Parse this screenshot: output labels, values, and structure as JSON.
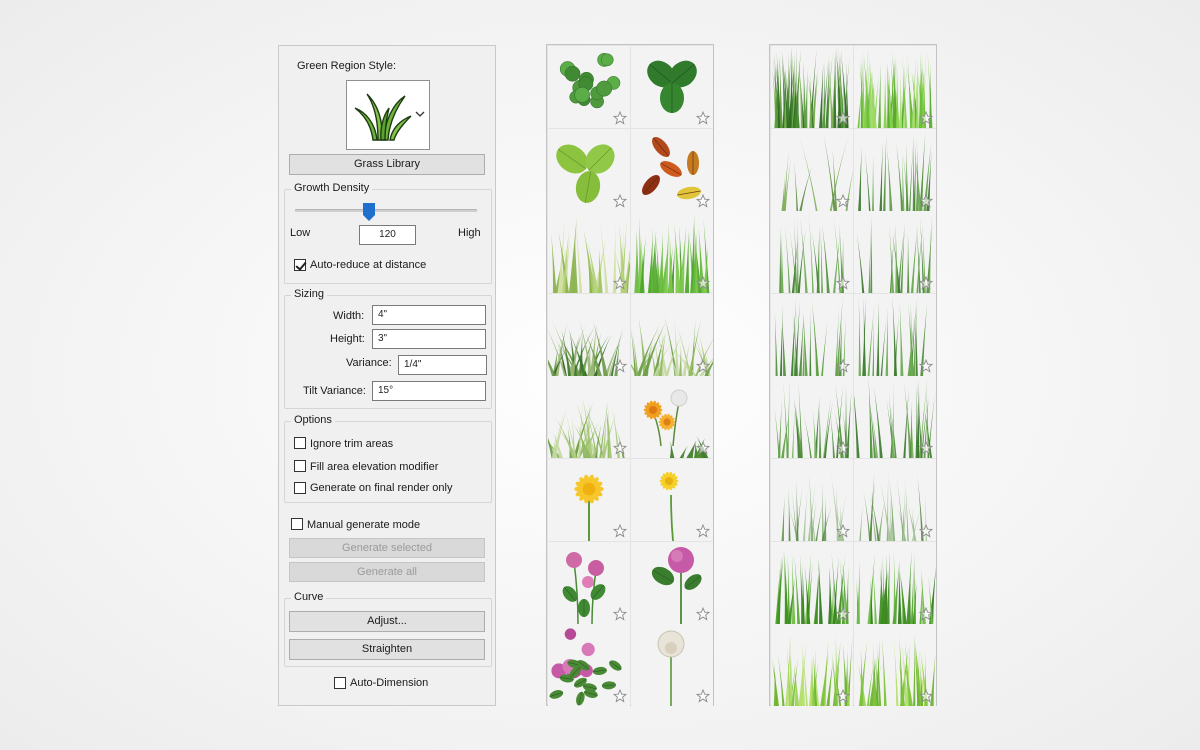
{
  "panel": {
    "green_region_style_label": "Green Region Style:",
    "library_button": "Grass Library",
    "growth": {
      "title": "Growth Density",
      "low": "Low",
      "high": "High",
      "value": "120",
      "auto_reduce": "Auto-reduce at distance",
      "auto_reduce_checked": true
    },
    "sizing": {
      "title": "Sizing",
      "width_label": "Width:",
      "width_value": "4\"",
      "height_label": "Height:",
      "height_value": "3\"",
      "variance_label": "Variance:",
      "variance_value": "1/4\"",
      "tilt_label": "Tilt Variance:",
      "tilt_value": "15°"
    },
    "options": {
      "title": "Options",
      "ignore_trim": "Ignore trim areas",
      "fill_elevation": "Fill area elevation modifier",
      "generate_final": "Generate on final render only"
    },
    "manual_mode": "Manual generate mode",
    "generate_selected": "Generate selected",
    "generate_all": "Generate all",
    "curve": {
      "title": "Curve",
      "adjust": "Adjust...",
      "straighten": "Straighten"
    },
    "auto_dimension": "Auto-Dimension"
  },
  "library_left": [
    {
      "name": "clover-leaves",
      "kind": "clover"
    },
    {
      "name": "three-leaves",
      "kind": "trileaf"
    },
    {
      "name": "light-green-leaves",
      "kind": "trileaf-light"
    },
    {
      "name": "autumn-leaves",
      "kind": "autumn"
    },
    {
      "name": "pale-grass",
      "kind": "grass-pale"
    },
    {
      "name": "green-grass",
      "kind": "grass-bright"
    },
    {
      "name": "ornamental-grass-dark",
      "kind": "tuft-dark"
    },
    {
      "name": "ornamental-grass-light",
      "kind": "tuft-light"
    },
    {
      "name": "grass-tuft",
      "kind": "tuft-light"
    },
    {
      "name": "dandelions",
      "kind": "dandelions"
    },
    {
      "name": "dandelion-yellow",
      "kind": "dandelion"
    },
    {
      "name": "dandelion-small",
      "kind": "dandelion-small"
    },
    {
      "name": "clover-flowers",
      "kind": "clover-flower"
    },
    {
      "name": "clover-flower-single",
      "kind": "clover-flower-single"
    },
    {
      "name": "clover-flower-bush",
      "kind": "clover-bush"
    },
    {
      "name": "white-clover-flower",
      "kind": "white-clover"
    }
  ],
  "library_right": [
    {
      "name": "lawn-grass-dark",
      "kind": "lawn-dark"
    },
    {
      "name": "lawn-grass-bright",
      "kind": "lawn-bright"
    },
    {
      "name": "sparse-blades-1",
      "kind": "blades-sparse"
    },
    {
      "name": "sparse-blades-2",
      "kind": "blades-tall"
    },
    {
      "name": "tall-blades-1",
      "kind": "blades-tall"
    },
    {
      "name": "tall-blades-2",
      "kind": "blades-tall"
    },
    {
      "name": "tall-blades-3",
      "kind": "blades-tall"
    },
    {
      "name": "tall-blades-4",
      "kind": "blades-tall"
    },
    {
      "name": "tall-blades-5",
      "kind": "blades-dense"
    },
    {
      "name": "tall-blades-6",
      "kind": "blades-dense"
    },
    {
      "name": "wild-grass-1",
      "kind": "blades-faded"
    },
    {
      "name": "wild-grass-2",
      "kind": "blades-faded"
    },
    {
      "name": "bright-grass-1",
      "kind": "blades-bright"
    },
    {
      "name": "bright-grass-2",
      "kind": "blades-bright"
    },
    {
      "name": "lime-grass-1",
      "kind": "blades-lime"
    },
    {
      "name": "lime-grass-2",
      "kind": "blades-lime"
    }
  ],
  "icons": {
    "favorite": "star-icon",
    "style_preview": "grass-icon",
    "dropdown": "chevron-down-icon"
  },
  "colors": {
    "slider_thumb": "#1f6fcf",
    "panel_bg": "#f0f0f0"
  }
}
